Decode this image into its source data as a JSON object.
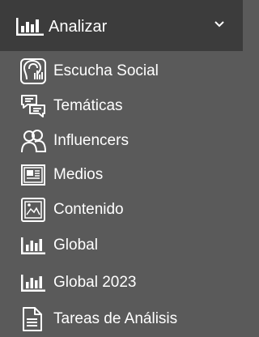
{
  "menu": {
    "header": {
      "label": "Analizar",
      "icon": "bar-chart-icon",
      "toggle_icon": "chevron-down-icon"
    },
    "items": [
      {
        "label": "Escucha Social",
        "icon": "social-listening-icon"
      },
      {
        "label": "Temáticas",
        "icon": "chat-bubbles-icon"
      },
      {
        "label": "Influencers",
        "icon": "users-icon"
      },
      {
        "label": "Medios",
        "icon": "newspaper-icon"
      },
      {
        "label": "Contenido",
        "icon": "content-image-icon"
      },
      {
        "label": "Global",
        "icon": "bar-chart-icon"
      },
      {
        "label": "Global 2023",
        "icon": "bar-chart-icon"
      },
      {
        "label": "Tareas de Análisis",
        "icon": "document-icon"
      }
    ]
  },
  "colors": {
    "background": "#5a5a5a",
    "header_background": "#3c3c3c",
    "text": "#ffffff"
  }
}
